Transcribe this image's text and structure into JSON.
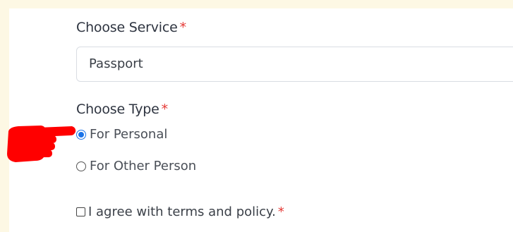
{
  "form": {
    "service": {
      "label": "Choose Service",
      "required_mark": "*",
      "selected_value": "Passport"
    },
    "type": {
      "label": "Choose Type",
      "required_mark": "*",
      "options": [
        {
          "label": "For Personal",
          "selected": true
        },
        {
          "label": "For Other Person",
          "selected": false
        }
      ]
    },
    "agreement": {
      "label": "I agree with terms and policy.",
      "required_mark": "*",
      "checked": false
    }
  },
  "annotation": {
    "icon": "pointing-hand-icon",
    "color": "#ff0000"
  },
  "colors": {
    "background": "#fdf8e4",
    "accent": "#1a73e8",
    "required": "#e53935"
  }
}
